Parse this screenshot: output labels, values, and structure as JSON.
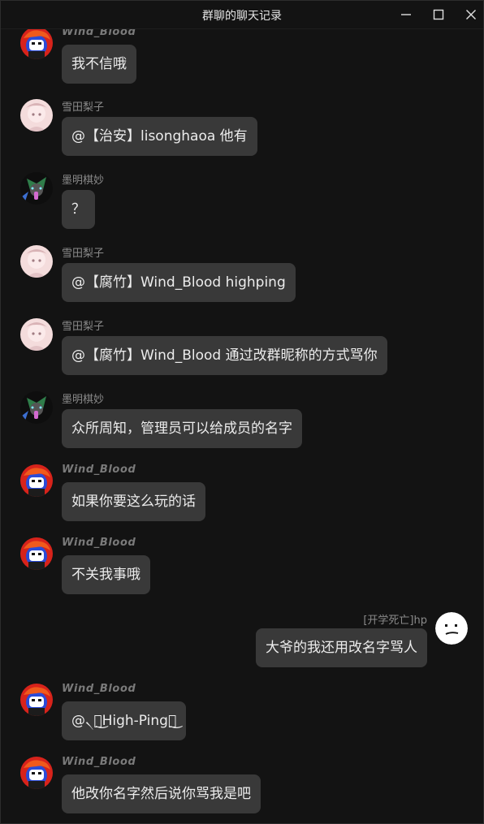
{
  "window": {
    "title": "群聊的聊天记录"
  },
  "messages": [
    {
      "sender": "Wind_Blood",
      "text": "我不信哦",
      "avatar": "wind-blood-avatar"
    },
    {
      "sender": "雪田梨子",
      "text": "@【治安】lisonghaoa 他有",
      "avatar": "yukida-avatar"
    },
    {
      "sender": "墨明棋妙",
      "text": "？",
      "avatar": "moming-avatar"
    },
    {
      "sender": "雪田梨子",
      "text": "@【腐竹】Wind_Blood highping",
      "avatar": "yukida-avatar"
    },
    {
      "sender": "雪田梨子",
      "text": "@【腐竹】Wind_Blood 通过改群昵称的方式骂你",
      "avatar": "yukida-avatar"
    },
    {
      "sender": "墨明棋妙",
      "text": "众所周知，管理员可以给成员的名字",
      "avatar": "moming-avatar"
    },
    {
      "sender": "Wind_Blood",
      "text": "如果你要这么玩的话",
      "avatar": "wind-blood-avatar"
    },
    {
      "sender": "Wind_Blood",
      "text": "不关我事哦",
      "avatar": "wind-blood-avatar"
    },
    {
      "sender": "[开学死亡]hp",
      "text": "大爷的我还用改名字骂人",
      "avatar": "hp-face-avatar",
      "self": true
    },
    {
      "sender": "Wind_Blood",
      "text": "@৲ঞ͜High-Pingঞ͜",
      "avatar": "wind-blood-avatar"
    },
    {
      "sender": "Wind_Blood",
      "text": "他改你名字然后说你骂我是吧",
      "avatar": "wind-blood-avatar"
    }
  ],
  "colors": {
    "background": "#131313",
    "bubble": "#393939",
    "name": "#8a8a8a",
    "text": "#ececec"
  }
}
